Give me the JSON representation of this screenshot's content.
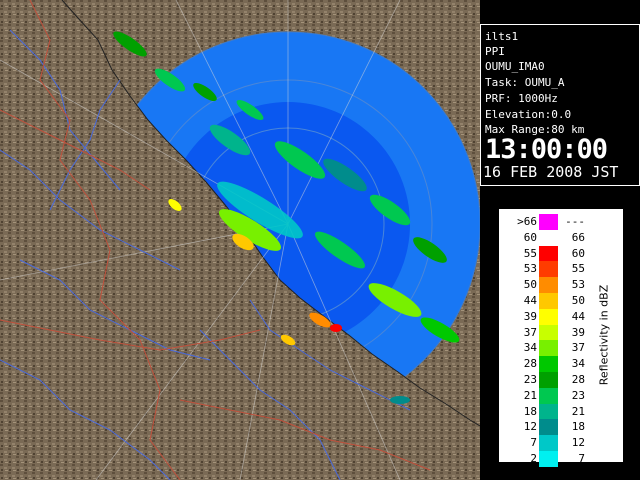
{
  "map": {
    "background": "#000000",
    "sea_color": "#0a58f0",
    "range_color": "#1877f4",
    "land_color": "#7a6a55",
    "river_color": "#4a6adc",
    "border_color": "#c0503c"
  },
  "info": {
    "site": "ilts1",
    "product": "PPI",
    "radar": "OUMU_IMA0",
    "task": "Task: OUMU_A",
    "prf": "PRF: 1000Hz",
    "elevation": "Elevation:0.0",
    "max_range": "Max Range:80 km",
    "time": "13:00:00",
    "date": "16 FEB 2008 JST"
  },
  "legend": {
    "title": "Reflectivity in dBZ",
    "rows": [
      {
        "lo": ">66",
        "hi": "---",
        "color": "#ff00ff"
      },
      {
        "lo": "60",
        "hi": "66",
        "color": "#ffffff"
      },
      {
        "lo": "55",
        "hi": "60",
        "color": "#ff0000"
      },
      {
        "lo": "53",
        "hi": "55",
        "color": "#ff3c00"
      },
      {
        "lo": "50",
        "hi": "53",
        "color": "#ff8c00"
      },
      {
        "lo": "44",
        "hi": "50",
        "color": "#ffc800"
      },
      {
        "lo": "39",
        "hi": "44",
        "color": "#ffff00"
      },
      {
        "lo": "37",
        "hi": "39",
        "color": "#c8ff00"
      },
      {
        "lo": "34",
        "hi": "37",
        "color": "#78f000"
      },
      {
        "lo": "28",
        "hi": "34",
        "color": "#00c800"
      },
      {
        "lo": "23",
        "hi": "28",
        "color": "#00a000"
      },
      {
        "lo": "21",
        "hi": "23",
        "color": "#00c850"
      },
      {
        "lo": "18",
        "hi": "21",
        "color": "#00b48c"
      },
      {
        "lo": "12",
        "hi": "18",
        "color": "#008c8c"
      },
      {
        "lo": "7",
        "hi": "12",
        "color": "#00c8c8"
      },
      {
        "lo": "2",
        "hi": "7",
        "color": "#00f0f0"
      }
    ]
  }
}
